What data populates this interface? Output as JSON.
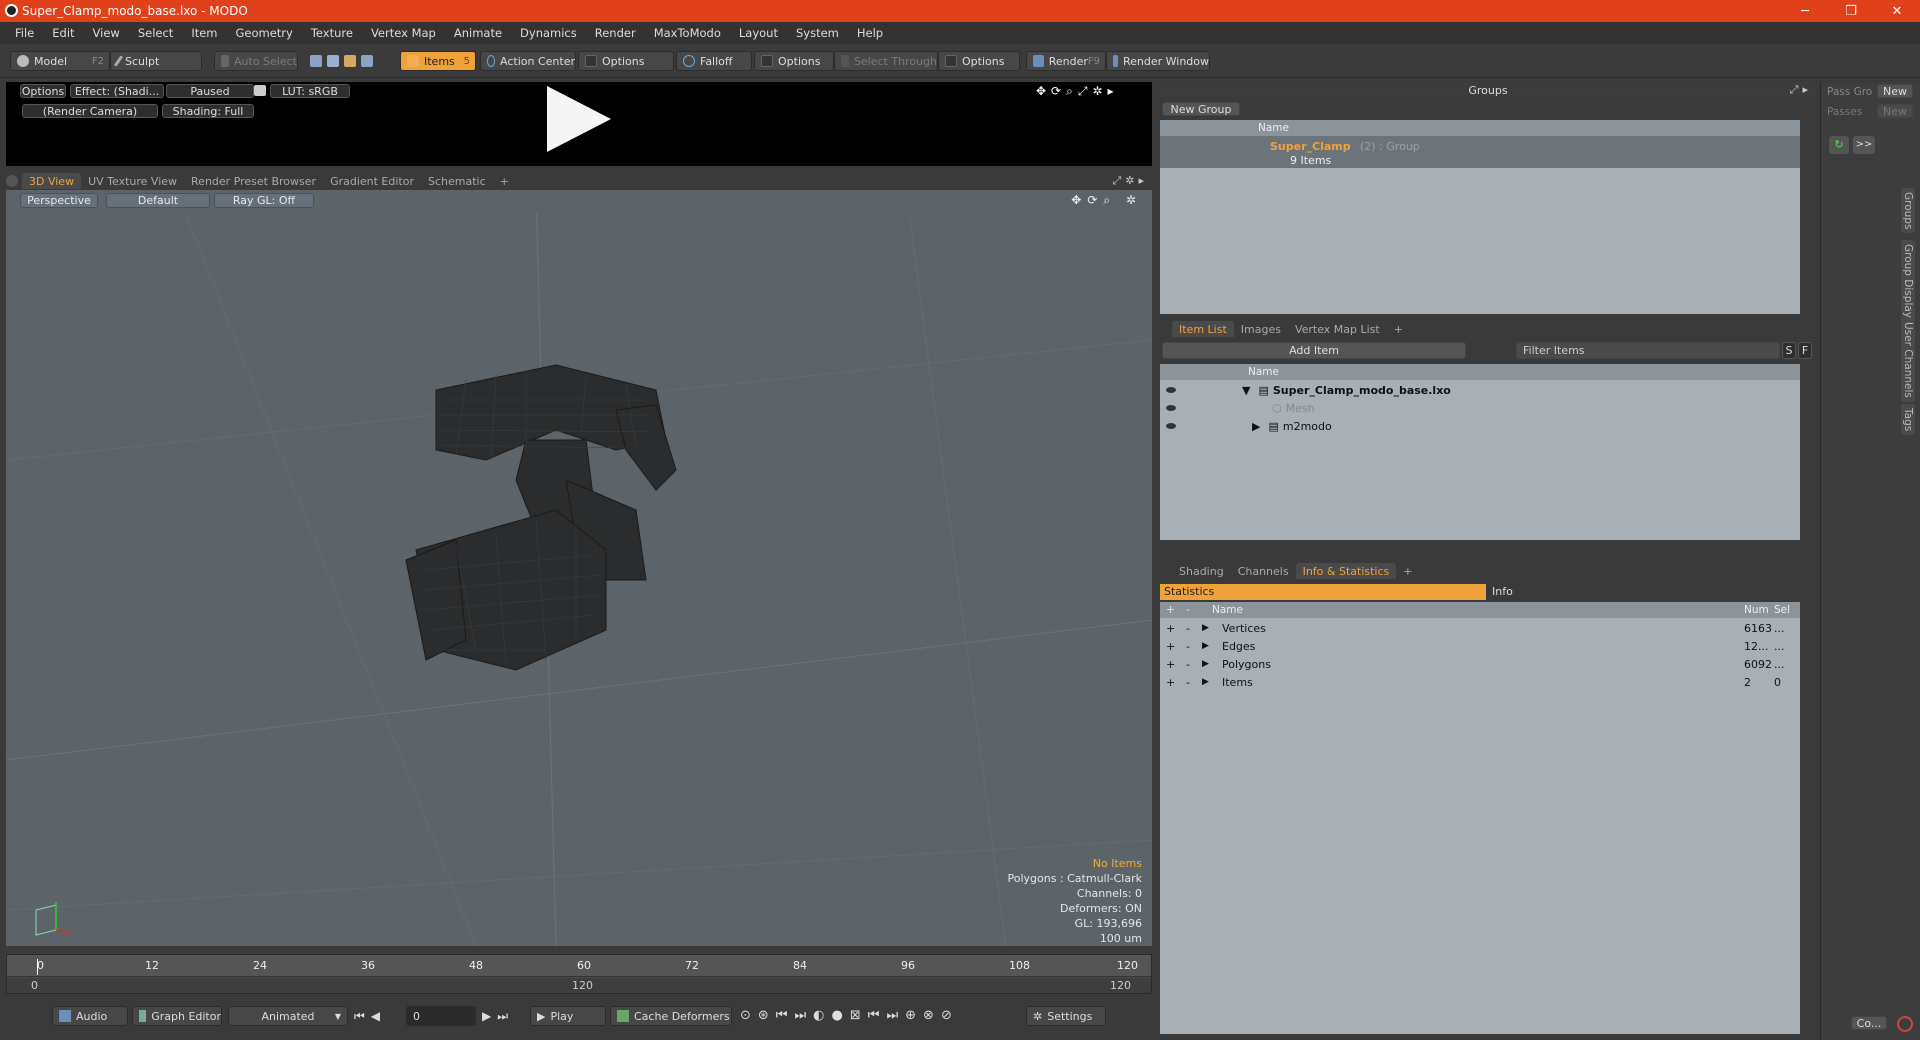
{
  "window": {
    "title": "Super_Clamp_modo_base.lxo - MODO",
    "minimize": "─",
    "maximize": "❐",
    "close": "✕"
  },
  "menu": [
    "File",
    "Edit",
    "View",
    "Select",
    "Item",
    "Geometry",
    "Texture",
    "Vertex Map",
    "Animate",
    "Dynamics",
    "Render",
    "MaxToModo",
    "Layout",
    "System",
    "Help"
  ],
  "toolbar": {
    "model": "Model",
    "model_key": "F2",
    "sculpt": "Sculpt",
    "auto_select": "Auto Select",
    "items": "Items",
    "items_key": "5",
    "action_center": "Action Center",
    "options1": "Options",
    "falloff": "Falloff",
    "options2": "Options",
    "select_through": "Select Through",
    "options3": "Options",
    "render": "Render",
    "render_key": "F9",
    "render_window": "Render Window"
  },
  "preview": {
    "options": "Options",
    "effect": "Effect: (Shadi...",
    "paused": "Paused",
    "lut": "LUT: sRGB",
    "camera": "(Render Camera)",
    "shading": "Shading: Full"
  },
  "viewport_tabs": [
    "3D View",
    "UV Texture View",
    "Render Preset Browser",
    "Gradient Editor",
    "Schematic",
    "+"
  ],
  "viewport": {
    "perspective": "Perspective",
    "default": "Default",
    "raygl": "Ray GL: Off",
    "info": {
      "no_items": "No Items",
      "polygons": "Polygons : Catmull-Clark",
      "channels": "Channels: 0",
      "deformers": "Deformers: ON",
      "gl": "GL: 193,696",
      "scale": "100 um"
    }
  },
  "timeline": {
    "ticks": [
      "0",
      "12",
      "24",
      "36",
      "48",
      "60",
      "72",
      "84",
      "96",
      "108",
      "120"
    ],
    "start": "0",
    "mid": "120",
    "end": "120"
  },
  "bottom": {
    "audio": "Audio",
    "graph_editor": "Graph Editor",
    "animated": "Animated",
    "frame": "0",
    "play": "Play",
    "cache_deformers": "Cache Deformers",
    "settings": "Settings"
  },
  "groups": {
    "title": "Groups",
    "new_group": "New Group",
    "col_name": "Name",
    "item_name": "Super_Clamp",
    "item_suffix": "(2) : Group",
    "item_count": "9 Items"
  },
  "itemlist": {
    "tabs": [
      "Item List",
      "Images",
      "Vertex Map List",
      "+"
    ],
    "add_item": "Add Item",
    "filter": "Filter Items",
    "s": "S",
    "f": "F",
    "col_name": "Name",
    "rows": [
      {
        "name": "Super_Clamp_modo_base.lxo"
      },
      {
        "name": "Mesh"
      },
      {
        "name": "m2modo"
      }
    ]
  },
  "stats": {
    "tabs": [
      "Shading",
      "Channels",
      "Info & Statistics",
      "+"
    ],
    "statistics": "Statistics",
    "info": "Info",
    "col_plus": "+",
    "col_minus": "-",
    "col_name": "Name",
    "col_num": "Num",
    "col_sel": "Sel",
    "rows": [
      {
        "name": "Vertices",
        "num": "6163",
        "sel": "..."
      },
      {
        "name": "Edges",
        "num": "12...",
        "sel": "..."
      },
      {
        "name": "Polygons",
        "num": "6092",
        "sel": "..."
      },
      {
        "name": "Items",
        "num": "2",
        "sel": "0"
      }
    ]
  },
  "right": {
    "pass_group": "Pass Gro",
    "new1": "New",
    "passes": "Passes",
    "new2": "New",
    "arrow": ">>",
    "vtabs": [
      "Groups",
      "Group Display",
      "User Channels",
      "Tags"
    ],
    "co": "Co..."
  },
  "colors": {
    "accent": "#f0a23a",
    "titlebar": "#e0401a"
  }
}
